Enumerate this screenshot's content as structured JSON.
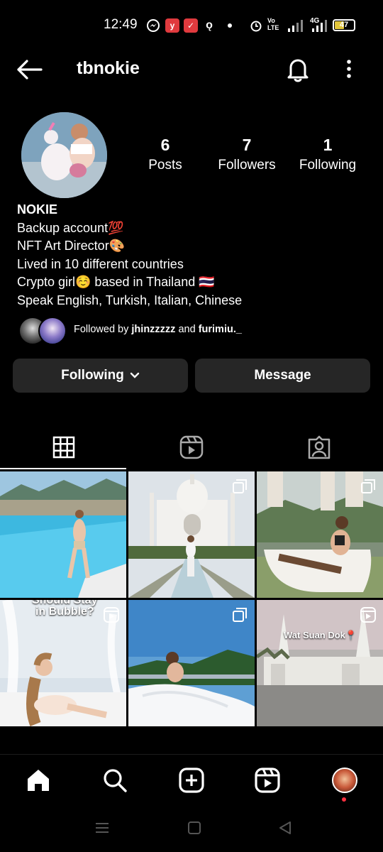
{
  "status_bar": {
    "time": "12:49",
    "network": "4G",
    "volte": "Vo LTE",
    "battery": "47"
  },
  "header": {
    "username": "tbnokie"
  },
  "stats": [
    {
      "value": "6",
      "label": "Posts"
    },
    {
      "value": "7",
      "label": "Followers"
    },
    {
      "value": "1",
      "label": "Following"
    }
  ],
  "bio": {
    "name": "NOKIE",
    "lines": [
      "Backup account💯",
      "NFT Art Director🎨",
      "Lived in 10 different countries",
      "Crypto girl☺️ based in Thailand 🇹🇭",
      "Speak English, Turkish, Italian, Chinese"
    ]
  },
  "followed_by": {
    "prefix": "Followed by",
    "user1": "jhinzzzzz",
    "joiner": "and",
    "user2": "furimiu._"
  },
  "buttons": {
    "following": "Following",
    "message": "Message"
  },
  "tabs": [
    "grid-icon",
    "reels-icon",
    "tagged-icon"
  ],
  "grid": [
    {
      "type": "post",
      "label": ""
    },
    {
      "type": "carousel",
      "label": ""
    },
    {
      "type": "carousel",
      "label": ""
    },
    {
      "type": "reel",
      "label": "in Bubble?",
      "label_top": "Should Stay"
    },
    {
      "type": "carousel",
      "label": ""
    },
    {
      "type": "reel",
      "label": "Wat Suan Dok📍"
    }
  ],
  "colors": {
    "background": "#000000",
    "button_bg": "#262626",
    "notification_dot": "#ff3040"
  }
}
